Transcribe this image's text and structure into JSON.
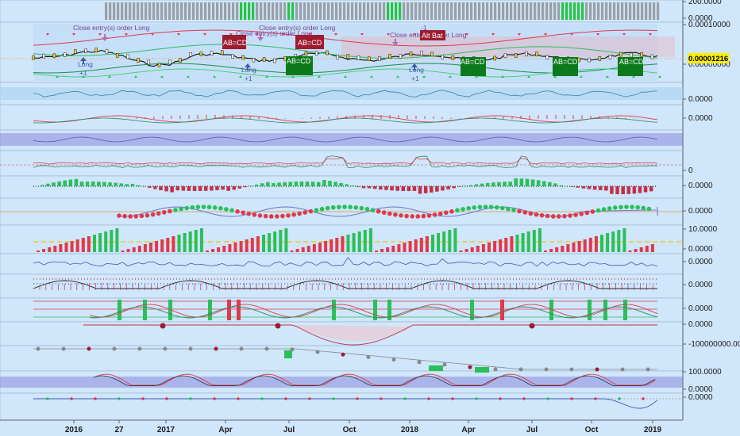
{
  "colors": {
    "background": "#cfe6fb",
    "pane_border": "#9ab3c8",
    "up": "#26c445",
    "down": "#e0394b",
    "price_tag": "#ffee00",
    "pattern_red": "#9e1b32",
    "pattern_green": "#0c7a1a",
    "volume_grey": "#9aa0a6",
    "violet": "#7b78d8"
  },
  "price_tag": "0.00001216",
  "chart_data": {
    "type": "line",
    "title": "",
    "x_labels": [
      "2016",
      "27",
      "2017",
      "Apr",
      "Jul",
      "Oct",
      "2018",
      "Apr",
      "Jul",
      "Oct",
      "2019"
    ],
    "panes": [
      {
        "name": "volume",
        "y_labels": [
          "200.0000",
          "0.0000"
        ]
      },
      {
        "name": "price",
        "y_labels": [
          "0.00010000",
          "0.00001216",
          "0.00000000"
        ]
      },
      {
        "name": "ind1",
        "y_labels": [
          "0.0000"
        ]
      },
      {
        "name": "ind2",
        "y_labels": [
          "0.0000"
        ]
      },
      {
        "name": "ind3",
        "y_labels": []
      },
      {
        "name": "ind4",
        "y_labels": [
          "0"
        ]
      },
      {
        "name": "ind5",
        "y_labels": [
          "0.0000"
        ]
      },
      {
        "name": "ind6",
        "y_labels": [
          "0.0000"
        ]
      },
      {
        "name": "ind7",
        "y_labels": [
          "10.0000",
          "0.0000"
        ]
      },
      {
        "name": "ind8",
        "y_labels": [
          "0.0000"
        ]
      },
      {
        "name": "ind9",
        "y_labels": [
          "0.0000"
        ]
      },
      {
        "name": "ind10",
        "y_labels": [
          "0.0000"
        ]
      },
      {
        "name": "ind11",
        "y_labels": [
          "0.0000"
        ]
      },
      {
        "name": "ind12",
        "y_labels": [
          "-100000000.0000"
        ]
      },
      {
        "name": "ind13",
        "y_labels": [
          "100.0000",
          "0.0000"
        ]
      },
      {
        "name": "ind14",
        "y_labels": [
          "0.0000"
        ]
      }
    ],
    "annotations": [
      "Close entry(s) order Long",
      "Close entry(s) order Long",
      "Close entry(s) order Long",
      "Close entry(s) order Long",
      "Long",
      "+1",
      "Long",
      "+1",
      "Long",
      "+1",
      "-1"
    ],
    "patterns": [
      {
        "label": "AB=CD",
        "kind": "bearish"
      },
      {
        "label": "AB=CD",
        "kind": "bearish"
      },
      {
        "label": "Alt Bat",
        "kind": "bearish"
      },
      {
        "label": "AB=CD",
        "kind": "bullish"
      },
      {
        "label": "AB=CD",
        "kind": "bullish"
      },
      {
        "label": "AB=CD",
        "kind": "bullish"
      },
      {
        "label": "AB=CD",
        "kind": "bullish"
      }
    ]
  }
}
